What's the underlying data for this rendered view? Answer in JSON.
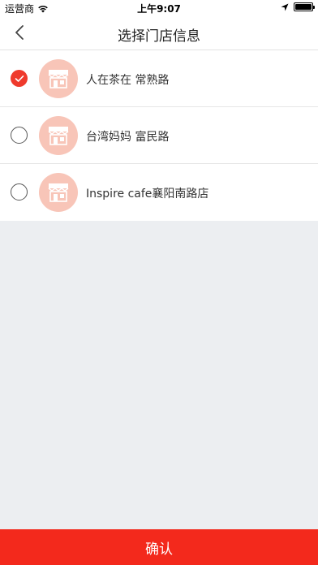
{
  "status_bar": {
    "carrier": "运营商",
    "time": "上午9:07"
  },
  "nav": {
    "title": "选择门店信息",
    "back_icon": "chevron-left-icon"
  },
  "stores": [
    {
      "name": "人在茶在 常熟路",
      "selected": true
    },
    {
      "name": "台湾妈妈 富民路",
      "selected": false
    },
    {
      "name": "Inspire cafe襄阳南路店",
      "selected": false
    }
  ],
  "confirm_label": "确认",
  "colors": {
    "accent": "#f3291c",
    "avatar_bg": "#f8c5b8",
    "page_bg": "#eceef1"
  }
}
